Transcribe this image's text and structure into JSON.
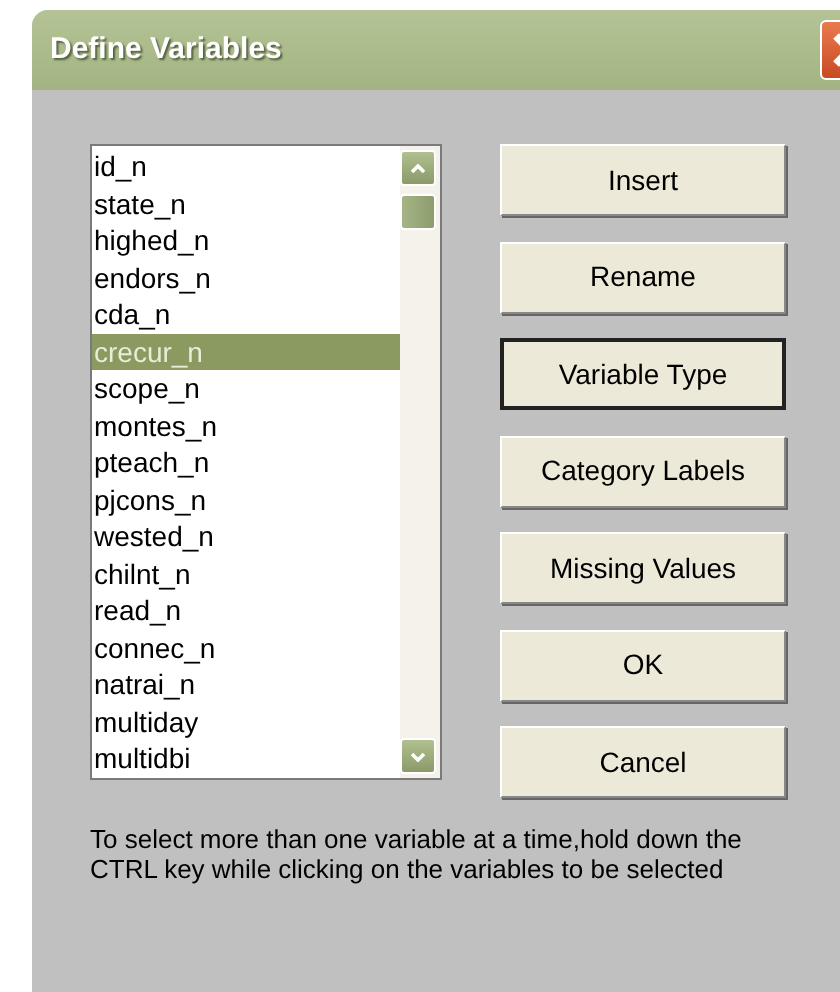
{
  "window": {
    "title": "Define Variables"
  },
  "variables": [
    {
      "name": "id_n",
      "selected": false
    },
    {
      "name": "state_n",
      "selected": false
    },
    {
      "name": "highed_n",
      "selected": false
    },
    {
      "name": "endors_n",
      "selected": false
    },
    {
      "name": "cda_n",
      "selected": false
    },
    {
      "name": "crecur_n",
      "selected": true
    },
    {
      "name": "scope_n",
      "selected": false
    },
    {
      "name": "montes_n",
      "selected": false
    },
    {
      "name": "pteach_n",
      "selected": false
    },
    {
      "name": "pjcons_n",
      "selected": false
    },
    {
      "name": "wested_n",
      "selected": false
    },
    {
      "name": "chilnt_n",
      "selected": false
    },
    {
      "name": "read_n",
      "selected": false
    },
    {
      "name": "connec_n",
      "selected": false
    },
    {
      "name": "natrai_n",
      "selected": false
    },
    {
      "name": "multiday",
      "selected": false
    },
    {
      "name": "multidbi",
      "selected": false
    }
  ],
  "buttons": [
    {
      "label": "Insert",
      "focused": false
    },
    {
      "label": "Rename",
      "focused": false
    },
    {
      "label": "Variable Type",
      "focused": true
    },
    {
      "label": "Category Labels",
      "focused": false
    },
    {
      "label": "Missing Values",
      "focused": false
    },
    {
      "label": "OK",
      "focused": false
    },
    {
      "label": "Cancel",
      "focused": false
    }
  ],
  "hint": "To select more than one variable at a time,hold down the CTRL key while clicking on the variables to be selected"
}
